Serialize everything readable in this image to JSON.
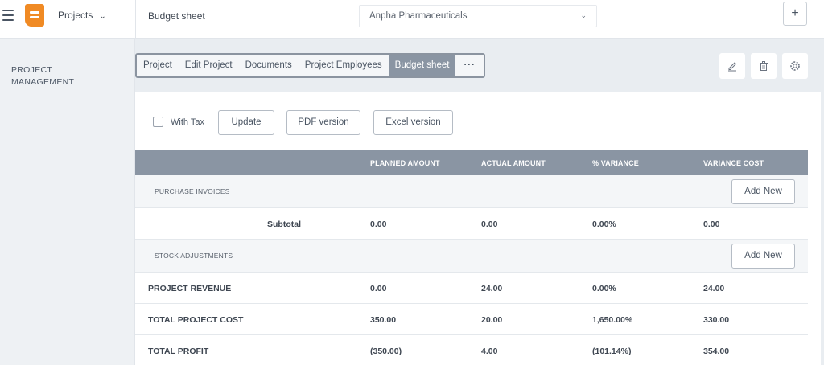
{
  "header": {
    "projects_label": "Projects",
    "breadcrumb": "Budget sheet",
    "company": "Anpha Pharmaceuticals",
    "add_icon": "plus-icon"
  },
  "sidebar": {
    "section_title": "PROJECT MANAGEMENT"
  },
  "tabs": [
    {
      "label": "Project",
      "active": false
    },
    {
      "label": "Edit Project",
      "active": false
    },
    {
      "label": "Documents",
      "active": false
    },
    {
      "label": "Project Employees",
      "active": false
    },
    {
      "label": "Budget sheet",
      "active": true
    },
    {
      "label": "···",
      "active": false
    }
  ],
  "actions": {
    "icons": [
      "edit-icon",
      "trash-icon",
      "gear-icon"
    ]
  },
  "toolbar": {
    "with_tax_label": "With Tax",
    "with_tax_checked": false,
    "update_label": "Update",
    "pdf_label": "PDF version",
    "excel_label": "Excel version"
  },
  "table": {
    "headers": [
      "PLANNED AMOUNT",
      "ACTUAL AMOUNT",
      "% VARIANCE",
      "VARIANCE COST"
    ],
    "sections": {
      "purchase_invoices": "PURCHASE INVOICES",
      "stock_adjustments": "STOCK ADJUSTMENTS",
      "add_new_label": "Add New"
    },
    "subtotal": {
      "label": "Subtotal",
      "values": [
        "0.00",
        "0.00",
        "0.00%",
        "0.00"
      ]
    },
    "project_revenue": {
      "label": "PROJECT REVENUE",
      "values": [
        "0.00",
        "24.00",
        "0.00%",
        "24.00"
      ]
    },
    "total_project_cost": {
      "label": "TOTAL PROJECT COST",
      "values": [
        "350.00",
        "20.00",
        "1,650.00%",
        "330.00"
      ]
    },
    "total_profit": {
      "label": "TOTAL PROFIT",
      "values": [
        "(350.00)",
        "4.00",
        "(101.14%)",
        "354.00"
      ]
    }
  },
  "colors": {
    "accent": "#f08a24",
    "header_bg": "#8a95a3",
    "page_bg": "#e9edf1"
  }
}
